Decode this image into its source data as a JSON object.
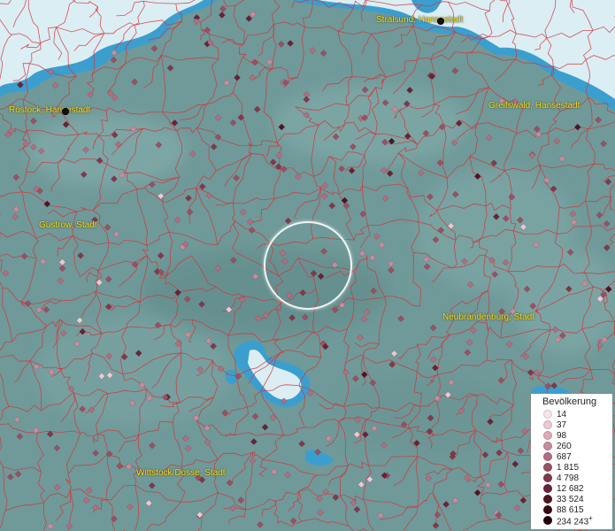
{
  "map": {
    "cities": [
      {
        "id": "stralsund",
        "name": "Stralsund, Hansestadt"
      },
      {
        "id": "rostock",
        "name": "Rostock, Hansestadt"
      },
      {
        "id": "greifswald",
        "name": "Greifswald, Hansestadt"
      },
      {
        "id": "guestrow",
        "name": "Güstrow, Stadt"
      },
      {
        "id": "neubrandenburg",
        "name": "Neubrandenburg, Stadt"
      },
      {
        "id": "wittstock",
        "name": "Wittstock/Dosse, Stadt"
      }
    ],
    "colors": {
      "land": "#6f9a99",
      "water": "#3a9fcf",
      "borders": "#d0353c",
      "label": "#f4e02a"
    }
  },
  "legend": {
    "title": "Bevölkerung",
    "items": [
      {
        "label": "14",
        "color": "#f6e6ec"
      },
      {
        "label": "37",
        "color": "#ecc9d3"
      },
      {
        "label": "98",
        "color": "#dcaab8"
      },
      {
        "label": "260",
        "color": "#c88c9d"
      },
      {
        "label": "687",
        "color": "#b26e81"
      },
      {
        "label": "1 815",
        "color": "#9a5064"
      },
      {
        "label": "4 798",
        "color": "#82384b"
      },
      {
        "label": "12 682",
        "color": "#6a2236"
      },
      {
        "label": "33 524",
        "color": "#521324"
      },
      {
        "label": "88 615",
        "color": "#3a0915"
      },
      {
        "label": "234 243",
        "color": "#22030b",
        "plus": "+"
      }
    ]
  }
}
